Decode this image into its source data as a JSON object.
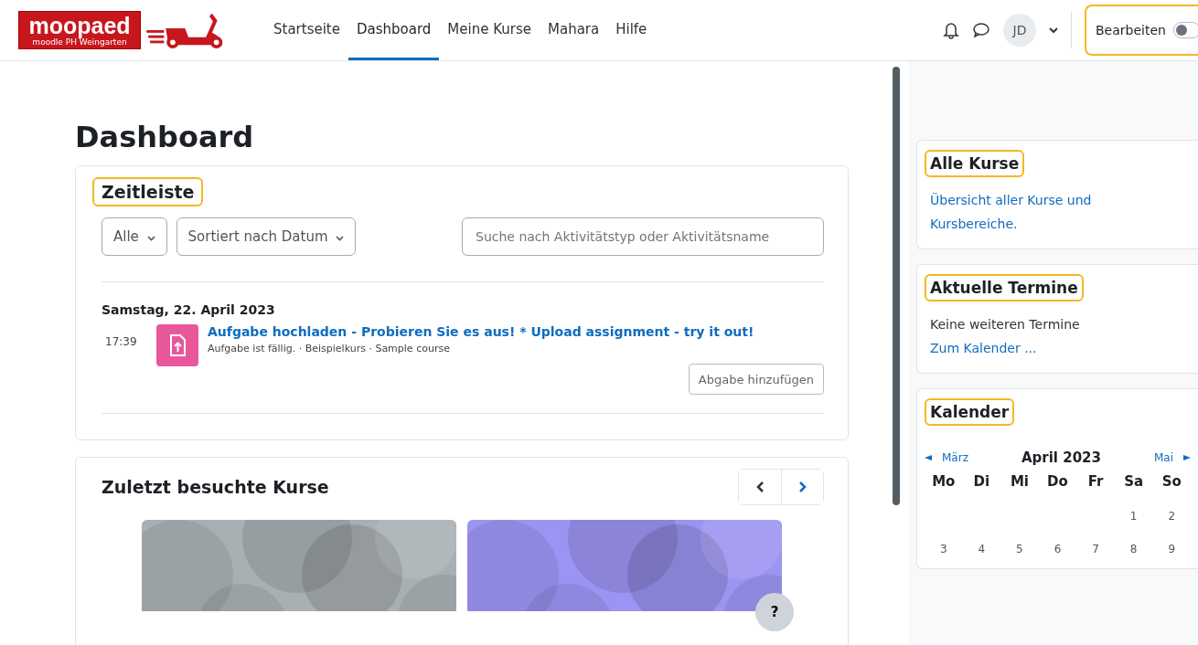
{
  "header": {
    "logo": {
      "name": "moopaed",
      "subtitle": "moodle PH Weingarten"
    },
    "nav": [
      {
        "label": "Startseite",
        "selected": false
      },
      {
        "label": "Dashboard",
        "selected": true
      },
      {
        "label": "Meine Kurse",
        "selected": false
      },
      {
        "label": "Mahara",
        "selected": false
      },
      {
        "label": "Hilfe",
        "selected": false
      }
    ],
    "avatar": "JD",
    "edit_mode": {
      "label": "Bearbeiten",
      "on": false,
      "highlighted": true
    }
  },
  "page_title": "Dashboard",
  "timeline": {
    "title": "Zeitleiste",
    "highlighted": true,
    "filter": "Alle",
    "sort": "Sortiert nach Datum",
    "search": {
      "placeholder": "Suche nach Aktivitätstyp oder Aktivitätsname"
    },
    "groups": [
      {
        "date": "Samstag, 22. April 2023",
        "events": [
          {
            "time": "17:39",
            "title": "Aufgabe hochladen - Probieren Sie es aus! * Upload assignment - try it out!",
            "meta": "Aufgabe ist fällig. · Beispielkurs · Sample course",
            "action": "Abgabe hinzufügen"
          }
        ]
      }
    ]
  },
  "recent_courses": {
    "title": "Zuletzt besuchte Kurse"
  },
  "help": "?",
  "sidebar": {
    "blocks": [
      {
        "kind": "text",
        "title": "Alle Kurse",
        "highlighted": true,
        "link": "Übersicht aller Kurse und Kursbereiche."
      },
      {
        "kind": "events",
        "title": "Aktuelle Termine",
        "highlighted": true,
        "text": "Keine weiteren Termine",
        "link": "Zum Kalender ..."
      },
      {
        "kind": "calendar",
        "title": "Kalender",
        "highlighted": true,
        "prev": "März",
        "month": "April 2023",
        "next": "Mai",
        "weekdays": [
          "Mo",
          "Di",
          "Mi",
          "Do",
          "Fr",
          "Sa",
          "So"
        ],
        "weeks": [
          [
            {
              "kind": "blank"
            },
            {
              "kind": "blank"
            },
            {
              "kind": "blank"
            },
            {
              "kind": "blank"
            },
            {
              "kind": "blank"
            },
            {
              "kind": "day",
              "label": "1"
            },
            {
              "kind": "day",
              "label": "2"
            }
          ],
          [
            {
              "kind": "day",
              "label": "3"
            },
            {
              "kind": "day",
              "label": "4"
            },
            {
              "kind": "day",
              "label": "5"
            },
            {
              "kind": "day",
              "label": "6"
            },
            {
              "kind": "day",
              "label": "7"
            },
            {
              "kind": "day",
              "label": "8"
            },
            {
              "kind": "day",
              "label": "9"
            }
          ]
        ]
      }
    ]
  }
}
